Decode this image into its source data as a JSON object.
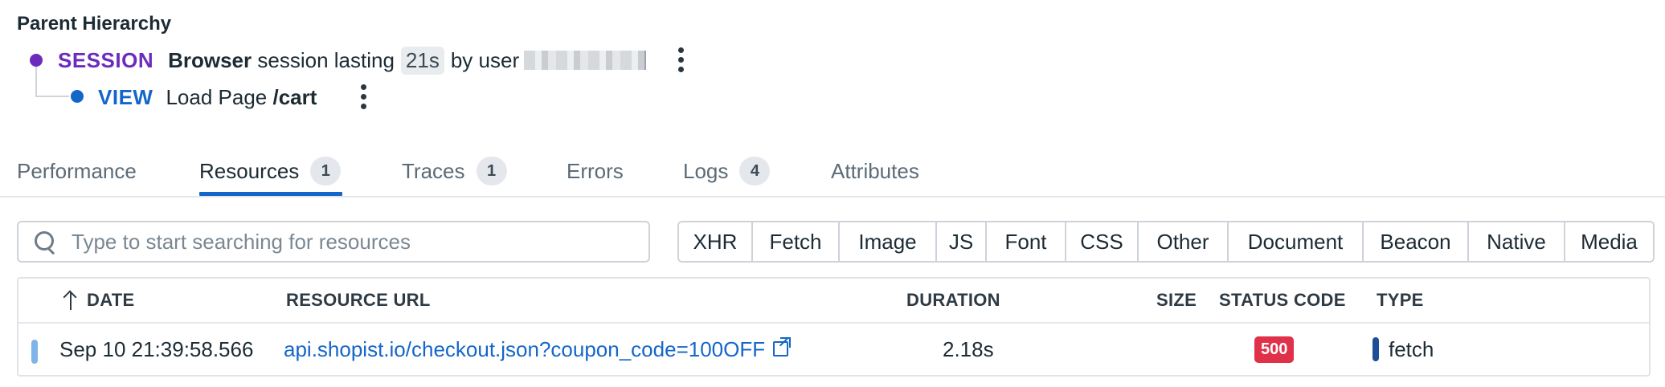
{
  "parent_hierarchy": {
    "title": "Parent Hierarchy",
    "session": {
      "kind": "SESSION",
      "strong": "Browser",
      "text_before": "session lasting",
      "duration": "21s",
      "text_by": "by user"
    },
    "view": {
      "kind": "VIEW",
      "text": "Load Page",
      "path": "/cart"
    }
  },
  "tabs": [
    {
      "label": "Performance",
      "count": null
    },
    {
      "label": "Resources",
      "count": "1"
    },
    {
      "label": "Traces",
      "count": "1"
    },
    {
      "label": "Errors",
      "count": null
    },
    {
      "label": "Logs",
      "count": "4"
    },
    {
      "label": "Attributes",
      "count": null
    }
  ],
  "active_tab": "Resources",
  "search": {
    "placeholder": "Type to start searching for resources",
    "value": ""
  },
  "filters": [
    "XHR",
    "Fetch",
    "Image",
    "JS",
    "Font",
    "CSS",
    "Other",
    "Document",
    "Beacon",
    "Native",
    "Media"
  ],
  "table": {
    "columns": {
      "date": "DATE",
      "url": "RESOURCE URL",
      "duration": "DURATION",
      "size": "SIZE",
      "status": "STATUS CODE",
      "type": "TYPE"
    },
    "rows": [
      {
        "date": "Sep 10 21:39:58.566",
        "url": "api.shopist.io/checkout.json?coupon_code=100OFF",
        "duration": "2.18s",
        "size": "",
        "status": "500",
        "type": "fetch"
      }
    ]
  },
  "colors": {
    "session": "#6b2bbd",
    "view": "#1466c8",
    "accent": "#1466c8",
    "error": "#e0314a",
    "fetch_type": "#1d4f96"
  },
  "icons": [
    "search-icon",
    "sort-ascending-icon",
    "external-link-icon",
    "kebab-menu-icon"
  ]
}
